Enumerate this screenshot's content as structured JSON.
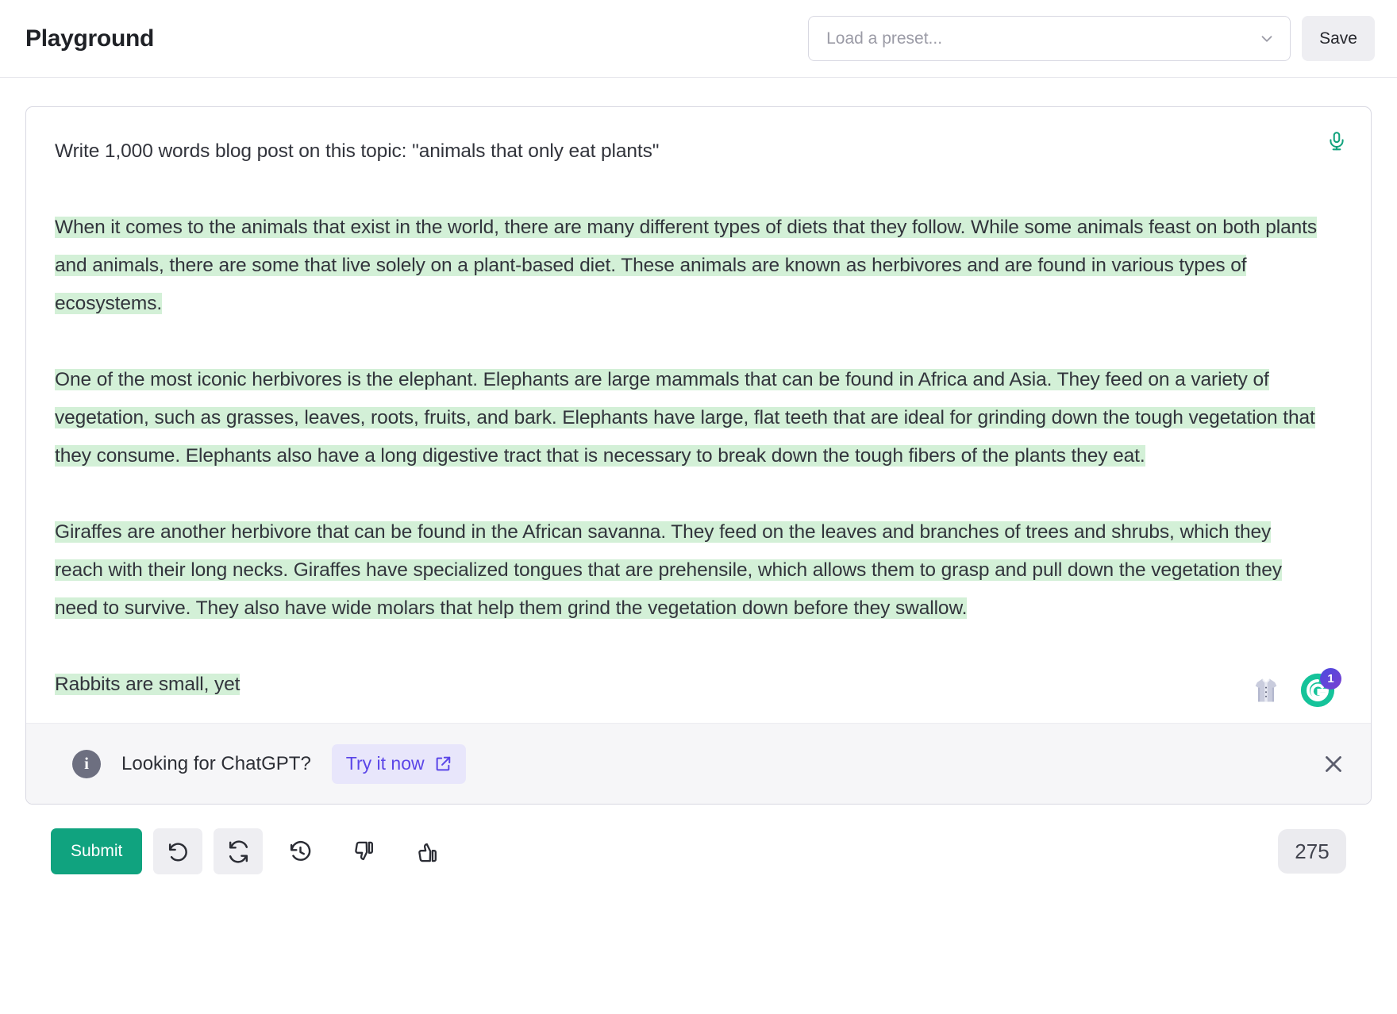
{
  "header": {
    "title": "Playground",
    "preset": {
      "placeholder": "Load a preset...",
      "value": "",
      "icon": "chevron-down-icon"
    },
    "save_label": "Save"
  },
  "editor": {
    "mic_icon": "microphone-icon",
    "prompt": "Write 1,000 words blog post on this topic: \"animals that only eat plants\"",
    "paragraphs": [
      "When it comes to the animals that exist in the world, there are many different types of diets that they follow. While some animals feast on both plants and animals, there are some that live solely on a plant-based diet. These animals are known as herbivores and are found in various types of ecosystems.",
      "One of the most iconic herbivores is the elephant. Elephants are large mammals that can be found in Africa and Asia. They feed on a variety of vegetation, such as grasses, leaves, roots, fruits, and bark. Elephants have large, flat teeth that are ideal for grinding down the tough vegetation that they consume. Elephants also have a long digestive tract that is necessary to break down the tough fibers of the plants they eat.",
      "Giraffes are another herbivore that can be found in the African savanna. They feed on the leaves and branches of trees and shrubs, which they reach with their long necks. Giraffes have specialized tongues that are prehensile, which allows them to grasp and pull down the vegetation they need to survive. They also have wide molars that help them grind the vegetation down before they swallow.",
      "Rabbits are small, yet"
    ],
    "highlight_color": "#d3f0d7",
    "overlays": {
      "shirt_icon": "dress-shirt-icon",
      "grammarly_icon": "grammarly-logo-icon",
      "grammarly_badge_count": "1"
    }
  },
  "banner": {
    "info_icon": "info-icon",
    "info_glyph": "i",
    "message": "Looking for ChatGPT?",
    "cta_label": "Try it now",
    "cta_icon": "external-link-icon",
    "close_icon": "close-icon"
  },
  "footer": {
    "submit_label": "Submit",
    "buttons": [
      {
        "name": "undo-button",
        "icon": "undo-icon"
      },
      {
        "name": "regenerate-button",
        "icon": "refresh-icon"
      },
      {
        "name": "history-button",
        "icon": "history-clock-icon"
      },
      {
        "name": "thumbs-down-button",
        "icon": "thumbs-down-icon"
      },
      {
        "name": "thumbs-up-button",
        "icon": "thumbs-up-icon"
      }
    ],
    "token_count": "275"
  },
  "colors": {
    "accent_green": "#10a37f",
    "highlight_green": "#d3f0d7",
    "cta_purple": "#5b46e8",
    "grammarly_green": "#15c39a"
  }
}
